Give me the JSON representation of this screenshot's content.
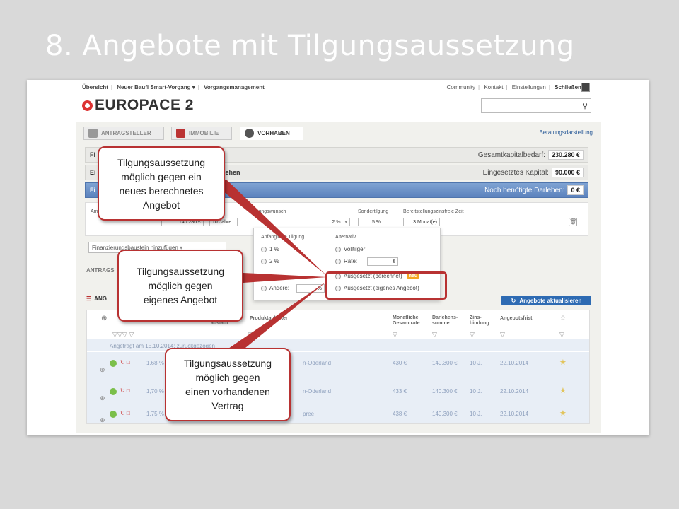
{
  "slide": {
    "title": "8. Angebote mit Tilgungsaussetzung"
  },
  "nav": {
    "left": [
      "Übersicht",
      "Neuer Baufi Smart-Vorgang ▾",
      "Vorgangsmanagement"
    ],
    "right": [
      "Community",
      "Kontakt",
      "Einstellungen"
    ],
    "close": "Schließen"
  },
  "brand": {
    "name": "EUROPACE 2"
  },
  "tabs": [
    {
      "label": "ANTRAGSTELLER",
      "icon": "person-icon"
    },
    {
      "label": "IMMOBILIE",
      "icon": "house-icon"
    },
    {
      "label": "VORHABEN",
      "icon": "euro-icon"
    }
  ],
  "beratung": "Beratungsdarstellung",
  "rows": {
    "r1": {
      "left": "Fi",
      "right_label": "Gesamtkapitalbedarf:",
      "right_value": "230.280 €"
    },
    "r2": {
      "left": "Ei",
      "mid": "d Drittdarlehen",
      "right_label": "Eingesetztes Kapital:",
      "right_value": "90.000 €"
    },
    "r3": {
      "left": "Fi",
      "right_label": "Noch benötigte Darlehen:",
      "right_value": "0 €"
    }
  },
  "edit": {
    "am_label": "Am",
    "tilgungswunsch_label": "lgungswunsch",
    "tilgungswunsch_value": "2 %",
    "betrag_value": "140.280 €",
    "laufzeit_value": "10 Jahre",
    "sondertilgung_label": "Sondertilgung",
    "sondertilgung_value": "5 %",
    "bereit_label": "Bereitstellungszinsfreie Zeit",
    "bereit_value": "3 Monat(e)"
  },
  "add_select": "Finanzierungsbaustein hinzufügen",
  "antrags_label": "ANTRAGS",
  "angebote_label": "ANG",
  "update_button": "Angebote aktualisieren",
  "popup": {
    "left_header": "Anfängliche Tilgung",
    "right_header": "Alternativ",
    "left_opts": [
      "1 %",
      "2 %"
    ],
    "andere": "Andere:",
    "andere_unit": "%",
    "right_opts": [
      "Volltilger",
      "Rate:"
    ],
    "rate_unit": "€",
    "aus_berechnet": "Ausgesetzt (berechnet)",
    "aus_eigen": "Ausgesetzt (eigenes Angebot)",
    "badge": "neu"
  },
  "table": {
    "headers": [
      "auslauf",
      "Produktanbieter",
      "Monatliche Gesamtrate",
      "Darlehens-summe",
      "Zins-bindung",
      "Angebotsfrist"
    ],
    "angefragt": "Angefragt am 15.10.2014: zurückgezogen",
    "rows": [
      {
        "zins": "1,68 %",
        "anbieter": "n-Oderland",
        "rate": "430 €",
        "summe": "140.300 €",
        "bindung": "10 J.",
        "frist": "22.10.2014"
      },
      {
        "zins": "1,70 %",
        "anbieter": "n-Oderland",
        "rate": "433 €",
        "summe": "140.300 €",
        "bindung": "10 J.",
        "frist": "22.10.2014"
      },
      {
        "zins": "1,75 %",
        "anbieter": "pree",
        "rate": "438 €",
        "summe": "140.300 €",
        "bindung": "10 J.",
        "frist": "22.10.2014"
      }
    ]
  },
  "callouts": {
    "c1": "Tilgungsaussetzung\nmöglich gegen ein\nneues berechnetes\nAngebot",
    "c2": "Tilgungsaussetzung\nmöglich gegen\neigenes Angebot",
    "c3": "Tilgungsaussetzung\nmöglich gegen\neinen vorhandenen\nVertrag"
  },
  "colors": {
    "accent": "#b83232",
    "blue": "#2e6bb3",
    "badge": "#f5a623"
  }
}
